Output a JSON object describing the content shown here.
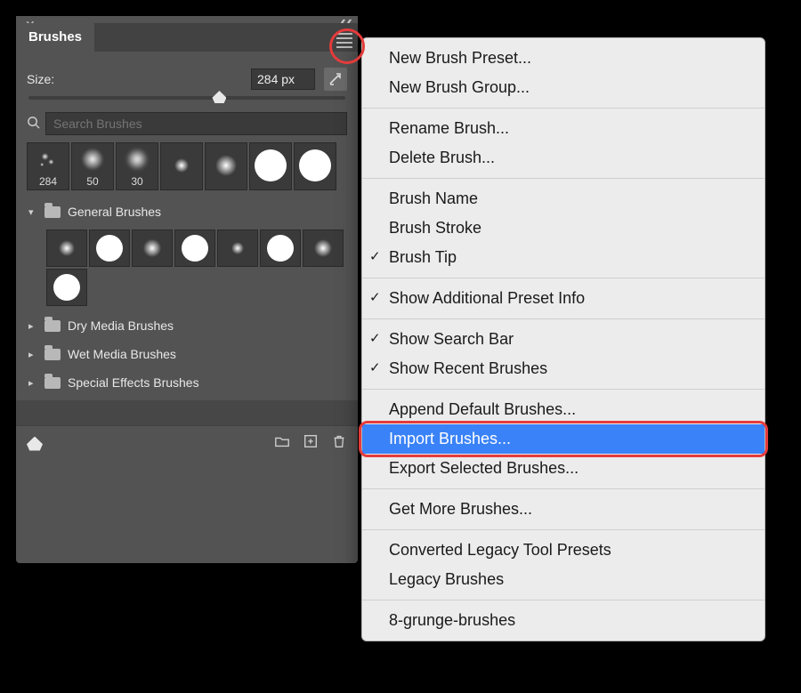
{
  "panel": {
    "title": "Brushes",
    "size_label": "Size:",
    "size_value": "284 px",
    "search_placeholder": "Search Brushes",
    "recent_sizes": [
      "284",
      "50",
      "30",
      "",
      "",
      "",
      ""
    ],
    "folders": {
      "general": "General Brushes",
      "dry": "Dry Media Brushes",
      "wet": "Wet Media Brushes",
      "sfx": "Special Effects Brushes"
    }
  },
  "menu": {
    "items": [
      {
        "label": "New Brush Preset...",
        "checked": false
      },
      {
        "label": "New Brush Group...",
        "checked": false
      },
      {
        "sep": true
      },
      {
        "label": "Rename Brush...",
        "checked": false
      },
      {
        "label": "Delete Brush...",
        "checked": false
      },
      {
        "sep": true
      },
      {
        "label": "Brush Name",
        "checked": false
      },
      {
        "label": "Brush Stroke",
        "checked": false
      },
      {
        "label": "Brush Tip",
        "checked": true
      },
      {
        "sep": true
      },
      {
        "label": "Show Additional Preset Info",
        "checked": true
      },
      {
        "sep": true
      },
      {
        "label": "Show Search Bar",
        "checked": true
      },
      {
        "label": "Show Recent Brushes",
        "checked": true
      },
      {
        "sep": true
      },
      {
        "label": "Append Default Brushes...",
        "checked": false
      },
      {
        "label": "Import Brushes...",
        "checked": false,
        "highlight": true
      },
      {
        "label": "Export Selected Brushes...",
        "checked": false
      },
      {
        "sep": true
      },
      {
        "label": "Get More Brushes...",
        "checked": false
      },
      {
        "sep": true
      },
      {
        "label": "Converted Legacy Tool Presets",
        "checked": false
      },
      {
        "label": "Legacy Brushes",
        "checked": false
      },
      {
        "sep": true
      },
      {
        "label": "8-grunge-brushes",
        "checked": false
      }
    ]
  }
}
